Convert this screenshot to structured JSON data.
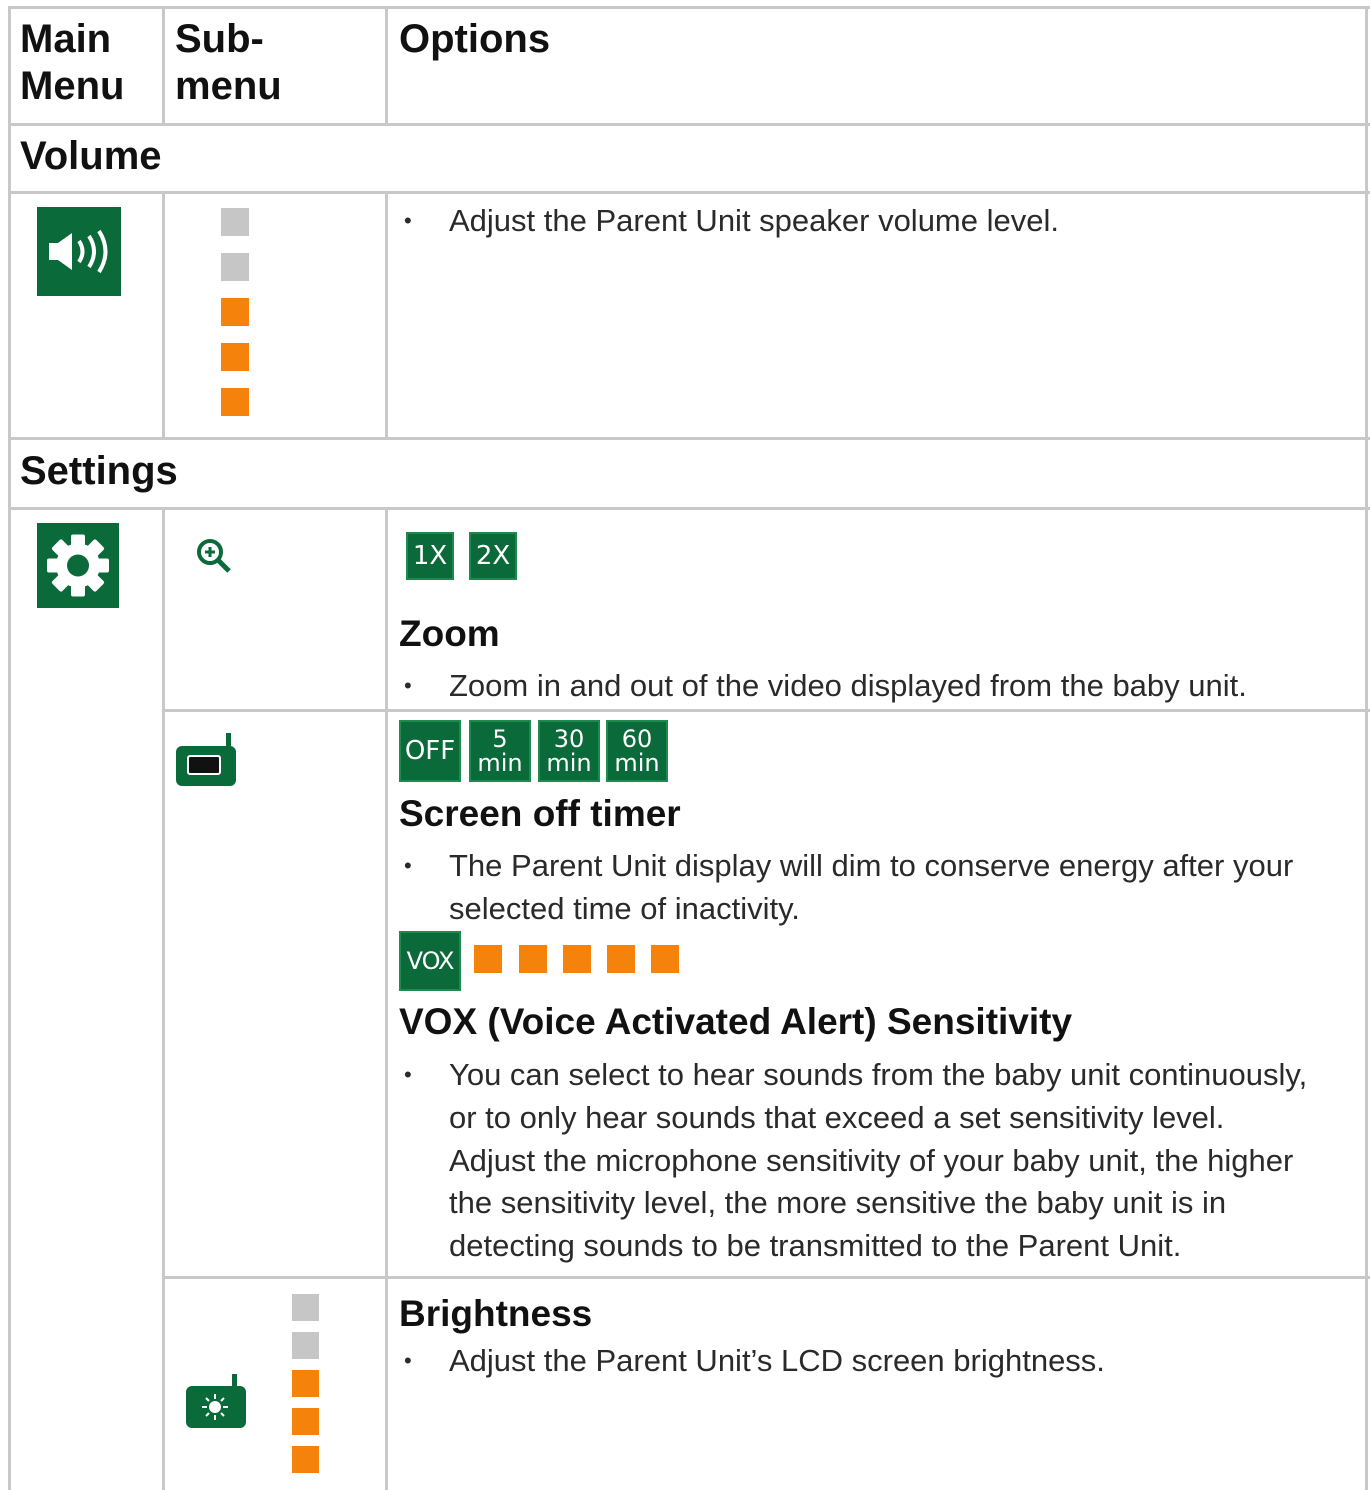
{
  "header": {
    "col1": [
      "Main",
      "Menu"
    ],
    "col2": [
      "Sub-",
      "menu"
    ],
    "col3": "Options"
  },
  "volume": {
    "section_title": "Volume",
    "main_icon": "speaker-icon",
    "levels": [
      "gray",
      "gray",
      "orange",
      "orange",
      "orange"
    ],
    "description": "Adjust the Parent Unit speaker volume level."
  },
  "settings": {
    "section_title": "Settings",
    "main_icon": "gear-icon",
    "zoom": {
      "icon": "zoom-in-icon",
      "options": [
        "1X",
        "2X"
      ],
      "title": "Zoom",
      "description": "Zoom in and out of the video displayed from the baby unit."
    },
    "screen_off_timer": {
      "icon": "parent-unit-icon",
      "options": [
        {
          "line1": "OFF",
          "line2": ""
        },
        {
          "line1": "5",
          "line2": "min"
        },
        {
          "line1": "30",
          "line2": "min"
        },
        {
          "line1": "60",
          "line2": "min"
        }
      ],
      "title": "Screen off timer",
      "description_line1": "The Parent Unit display will dim to conserve energy after your",
      "description_line2": "selected time of inactivity."
    },
    "vox": {
      "label": "VOX",
      "levels": [
        "orange",
        "orange",
        "orange",
        "orange",
        "orange"
      ],
      "title": "VOX (Voice Activated Alert) Sensitivity",
      "description_lines": [
        "You can select to hear sounds from the baby unit continuously,",
        "or to only hear sounds that exceed a set sensitivity level.",
        "Adjust the microphone sensitivity of your baby unit, the higher",
        "the sensitivity level, the more sensitive the baby unit is in",
        "detecting sounds to be transmitted to the Parent Unit."
      ]
    },
    "brightness": {
      "icon": "brightness-icon",
      "levels": [
        "gray",
        "gray",
        "orange",
        "orange",
        "orange"
      ],
      "title": "Brightness",
      "description": "Adjust the Parent Unit’s LCD screen brightness."
    }
  },
  "colors": {
    "green": "#0b6a3a",
    "orange": "#f5820a",
    "gray": "#c6c6c6",
    "rule": "#c8c8c8"
  }
}
